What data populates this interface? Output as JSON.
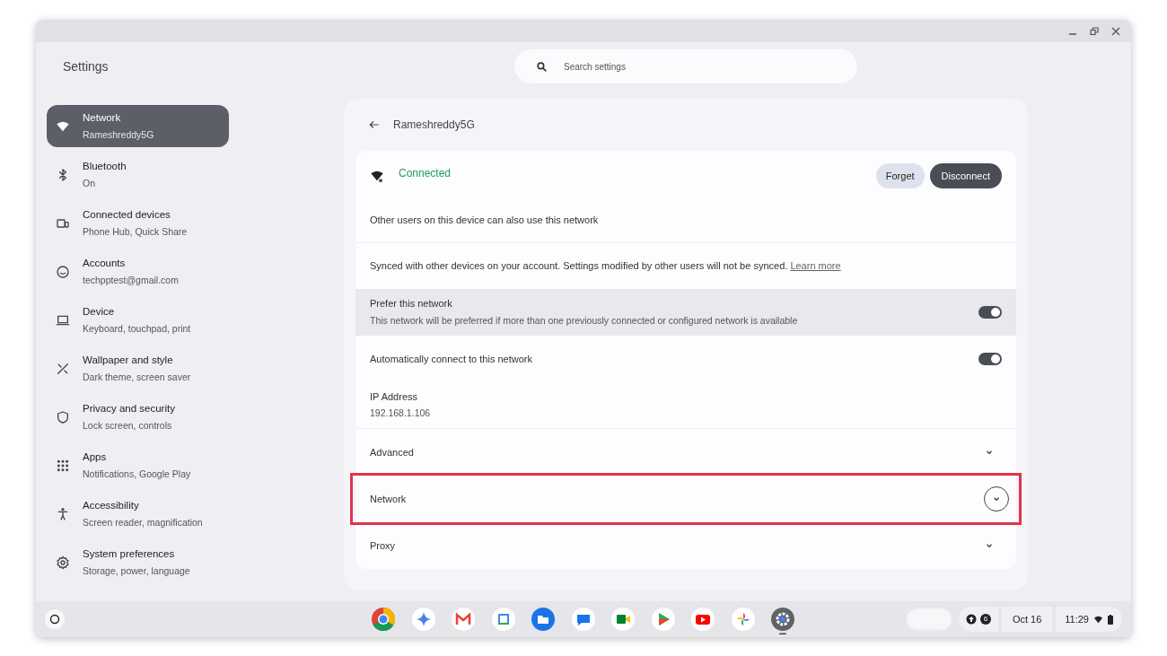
{
  "window": {
    "title": "Settings"
  },
  "search": {
    "placeholder": "Search settings"
  },
  "sidebar": {
    "items": [
      {
        "title": "Network",
        "subtitle": "Rameshreddy5G",
        "selected": true
      },
      {
        "title": "Bluetooth",
        "subtitle": "On",
        "selected": false
      },
      {
        "title": "Connected devices",
        "subtitle": "Phone Hub, Quick Share",
        "selected": false
      },
      {
        "title": "Accounts",
        "subtitle": "techpptest@gmail.com",
        "selected": false
      },
      {
        "title": "Device",
        "subtitle": "Keyboard, touchpad, print",
        "selected": false
      },
      {
        "title": "Wallpaper and style",
        "subtitle": "Dark theme, screen saver",
        "selected": false
      },
      {
        "title": "Privacy and security",
        "subtitle": "Lock screen, controls",
        "selected": false
      },
      {
        "title": "Apps",
        "subtitle": "Notifications, Google Play",
        "selected": false
      },
      {
        "title": "Accessibility",
        "subtitle": "Screen reader, magnification",
        "selected": false
      },
      {
        "title": "System preferences",
        "subtitle": "Storage, power, language",
        "selected": false
      }
    ]
  },
  "page": {
    "title": "Rameshreddy5G",
    "status": "Connected",
    "buttons": [
      {
        "label": "Forget",
        "kind": "secondary"
      },
      {
        "label": "Disconnect",
        "kind": "primary"
      }
    ],
    "rows": [
      {
        "kind": "text",
        "text": "Other users on this device can also use this network"
      },
      {
        "kind": "link_text",
        "text": "Synced with other devices on your account. Settings modified by other users will not be synced.",
        "link": "Learn more"
      },
      {
        "kind": "toggle",
        "title": "Prefer this network",
        "subtitle": "This network will be preferred if more than one previously connected or configured network is available",
        "on": true,
        "highlighted": true
      },
      {
        "kind": "toggle",
        "title": "Automatically connect to this network",
        "on": true,
        "highlighted": false
      },
      {
        "kind": "info",
        "title": "IP Address",
        "subtitle": "192.168.1.106"
      },
      {
        "kind": "expander",
        "title": "Advanced",
        "expanded": false,
        "focused": false,
        "annotated": false
      },
      {
        "kind": "expander",
        "title": "Network",
        "expanded": false,
        "focused": true,
        "annotated": true
      },
      {
        "kind": "expander",
        "title": "Proxy",
        "expanded": false,
        "focused": false,
        "annotated": false
      }
    ]
  },
  "shelf": {
    "apps": [
      {
        "running": false
      },
      {
        "running": false
      },
      {
        "running": false
      },
      {
        "running": false
      },
      {
        "running": false
      },
      {
        "running": false
      },
      {
        "running": false
      },
      {
        "running": false
      },
      {
        "running": false
      },
      {
        "running": false
      },
      {
        "running": true
      }
    ],
    "notification_count": "6",
    "date": "Oct 16",
    "time": "11:29"
  }
}
